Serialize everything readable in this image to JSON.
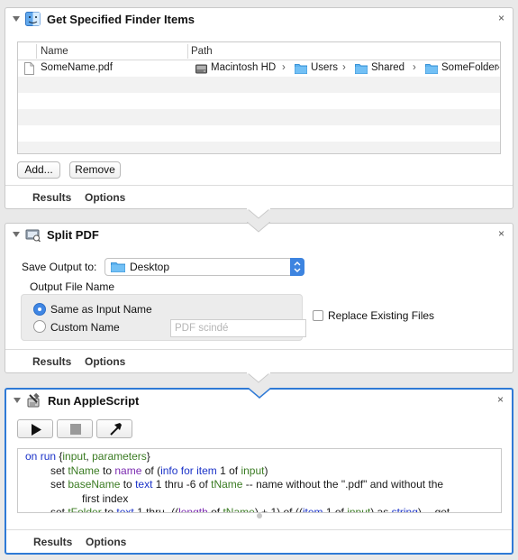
{
  "finder_action": {
    "title": "Get Specified Finder Items",
    "close": "×",
    "columns": {
      "name": "Name",
      "path": "Path"
    },
    "items": [
      {
        "name": "SomeName.pdf",
        "path": [
          {
            "label": "Macintosh HD",
            "icon": "hard-drive-icon"
          },
          {
            "label": "Users",
            "icon": "folder-icon"
          },
          {
            "label": "Shared",
            "icon": "folder-icon"
          },
          {
            "label": "SomeFolder",
            "icon": "folder-icon"
          }
        ]
      }
    ],
    "path_separator": "›",
    "add_button": "Add...",
    "remove_button": "Remove",
    "tabs": [
      "Results",
      "Options"
    ]
  },
  "split_action": {
    "title": "Split PDF",
    "close": "×",
    "save_output_label": "Save Output to:",
    "save_output_value": "Desktop",
    "output_name_label": "Output File Name",
    "radio_same": "Same as Input Name",
    "radio_custom": "Custom Name",
    "custom_placeholder": "PDF scindé",
    "replace_label": "Replace Existing Files",
    "tabs": [
      "Results",
      "Options"
    ]
  },
  "script_action": {
    "title": "Run AppleScript",
    "close": "×",
    "code": {
      "l1": {
        "a": "on",
        "b": " run ",
        "c": "{",
        "d": "input",
        "e": ", ",
        "f": "parameters",
        "g": "}"
      },
      "l2": {
        "a": "set ",
        "b": "tName",
        "c": " to ",
        "d": "name",
        "e": " of (",
        "f": "info for",
        "g": " ",
        "h": "item",
        "i": " 1 of ",
        "j": "input",
        "k": ")"
      },
      "l3": {
        "a": "set ",
        "b": "baseName",
        "c": " to ",
        "d": "text",
        "e": " 1 thru -6 of ",
        "f": "tName",
        "g": " -- name without the \".pdf\" and without the"
      },
      "l4": {
        "a": "first index"
      },
      "l5": {
        "a": "set ",
        "b": "tFolder",
        "c": " to ",
        "d": "text",
        "e": " 1 thru -((",
        "f": "length",
        "g": " of ",
        "h": "tName",
        "i": ") + 1) of ((",
        "j": "item",
        "k": " 1 of ",
        "l": "input",
        "m": ") as ",
        "n": "string",
        "o": ") -- get"
      }
    },
    "tabs": [
      "Results",
      "Options"
    ]
  }
}
